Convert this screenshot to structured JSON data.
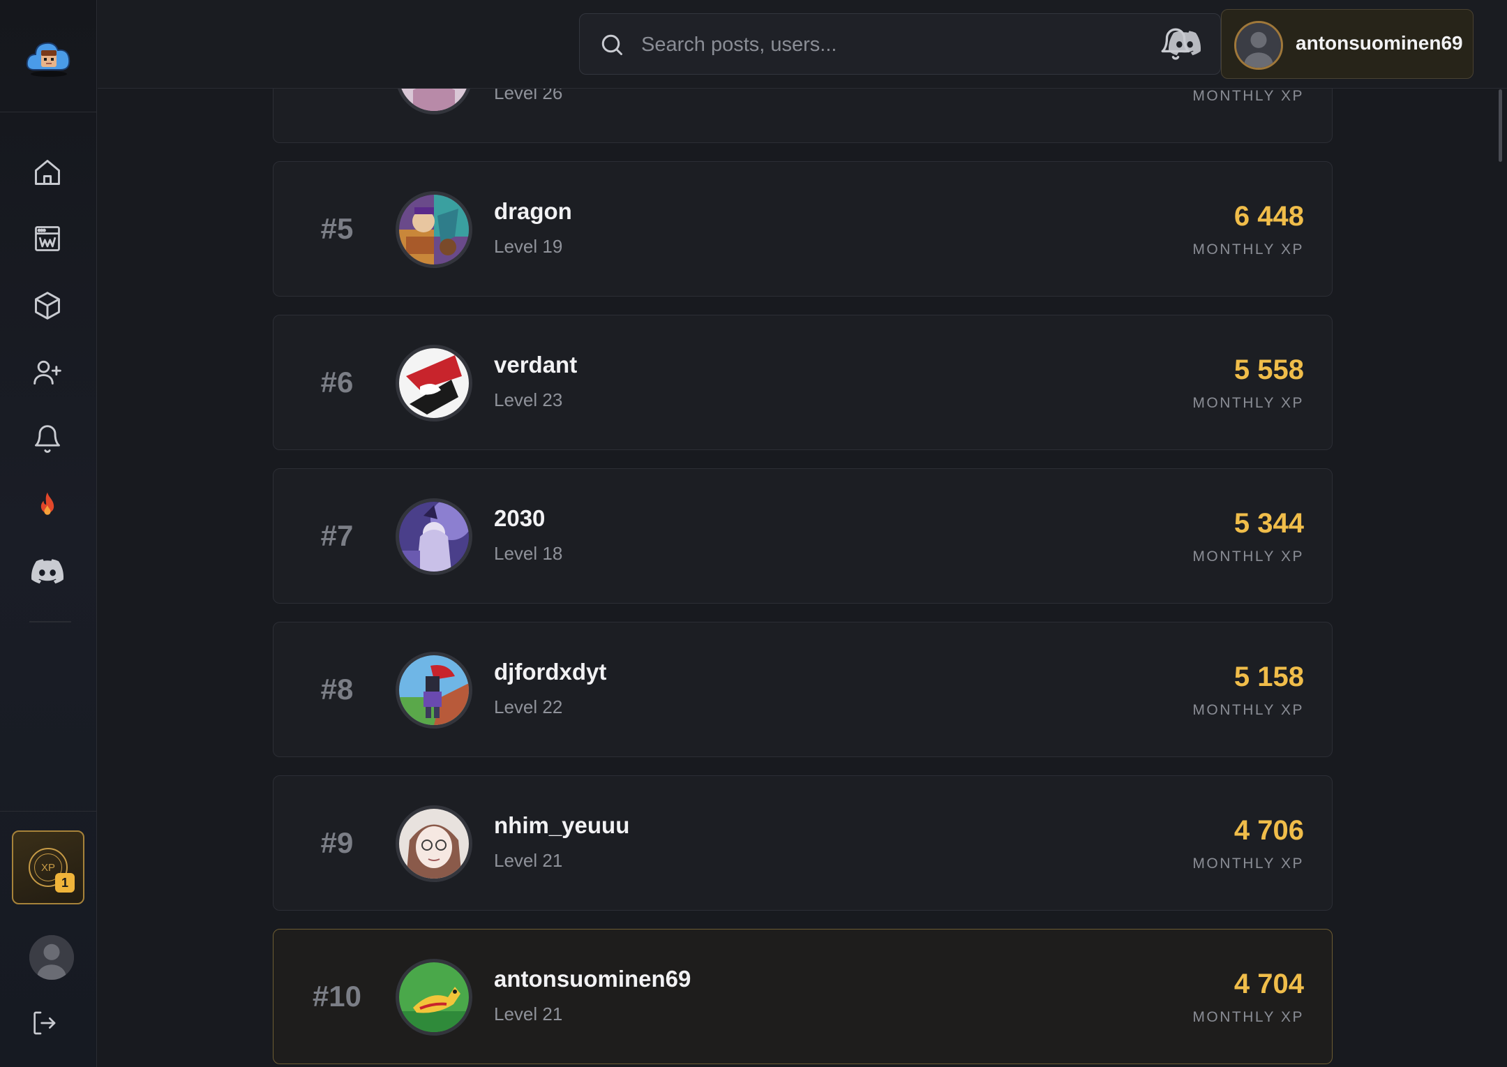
{
  "search": {
    "placeholder": "Search posts, users..."
  },
  "user": {
    "username": "antonsuominen69"
  },
  "sidebar": {
    "items": [
      {
        "icon": "home-icon"
      },
      {
        "icon": "wiki-icon"
      },
      {
        "icon": "cube-icon"
      },
      {
        "icon": "add-user-icon"
      },
      {
        "icon": "bell-icon"
      },
      {
        "icon": "fire-icon"
      },
      {
        "icon": "discord-icon"
      }
    ],
    "xp_badge_label": "XP",
    "xp_badge_count": "1"
  },
  "leaderboard": {
    "xp_label": "MONTHLY XP",
    "rows": [
      {
        "rank": "",
        "name": "",
        "level": "Level 26",
        "xp": ""
      },
      {
        "rank": "#5",
        "name": "dragon",
        "level": "Level 19",
        "xp": "6 448"
      },
      {
        "rank": "#6",
        "name": "verdant",
        "level": "Level 23",
        "xp": "5 558"
      },
      {
        "rank": "#7",
        "name": "2030",
        "level": "Level 18",
        "xp": "5 344"
      },
      {
        "rank": "#8",
        "name": "djfordxdyt",
        "level": "Level 22",
        "xp": "5 158"
      },
      {
        "rank": "#9",
        "name": "nhim_yeuuu",
        "level": "Level 21",
        "xp": "4 706"
      },
      {
        "rank": "#10",
        "name": "antonsuominen69",
        "level": "Level 21",
        "xp": "4 704"
      }
    ]
  },
  "colors": {
    "accent_gold": "#f0bd4a",
    "background": "#181a1f",
    "card": "#1c1e23",
    "current_user_border": "#6e5d33"
  }
}
